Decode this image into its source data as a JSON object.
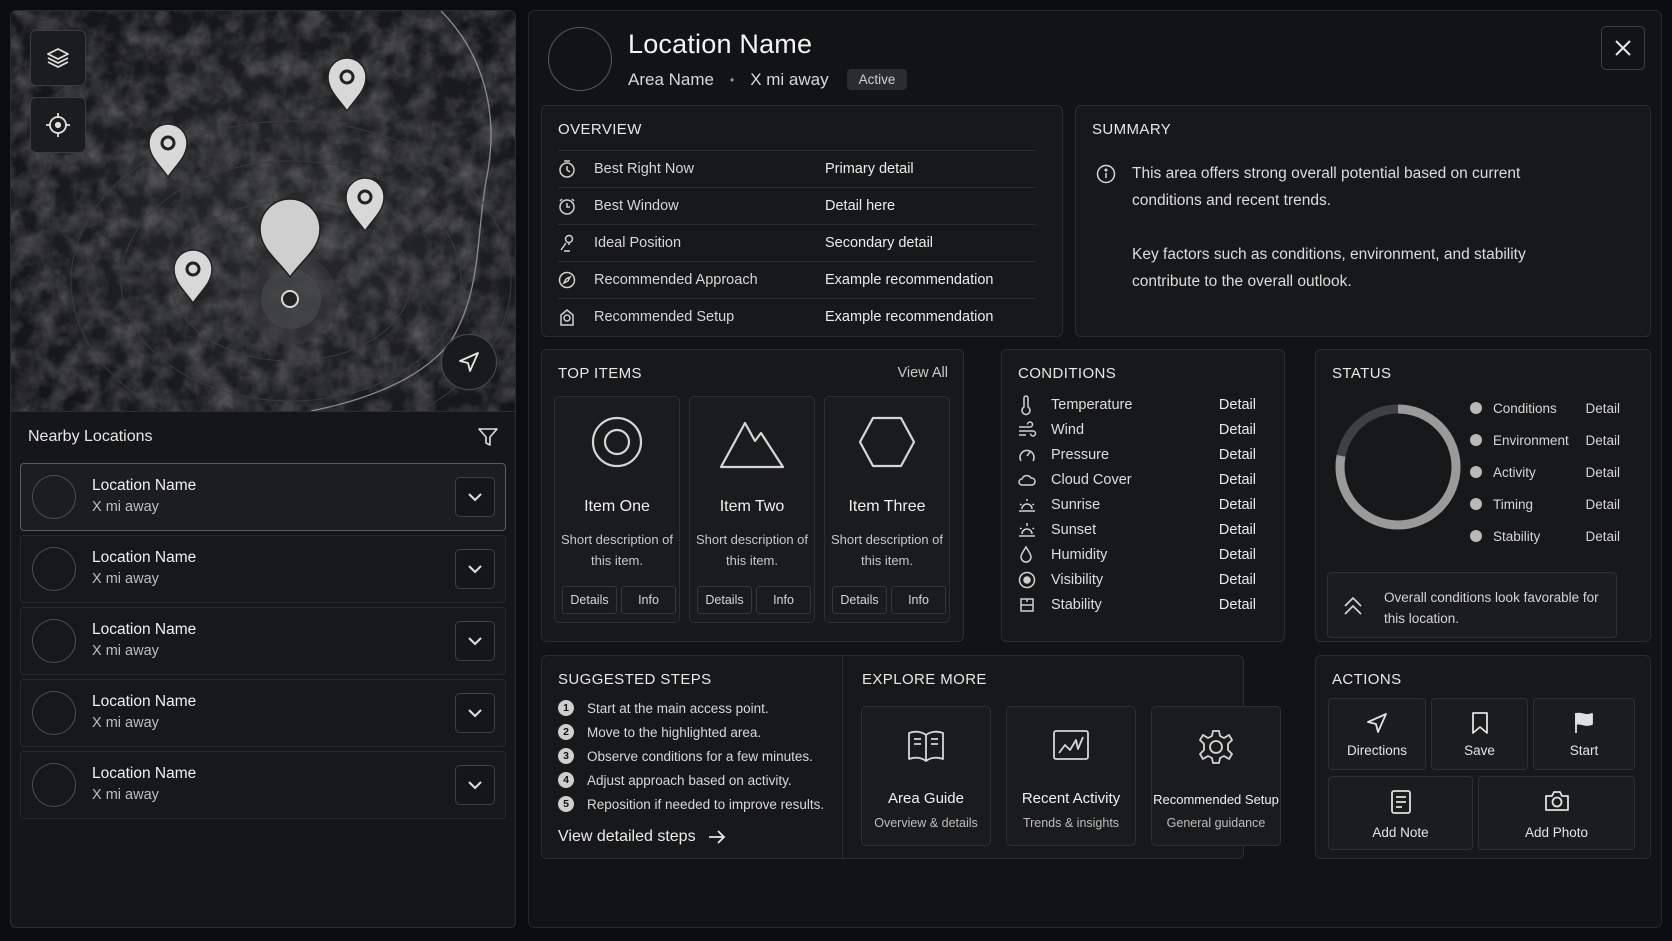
{
  "nearby": {
    "title": "Nearby Locations",
    "items": [
      {
        "name": "Location Name",
        "distance": "X mi away"
      },
      {
        "name": "Location Name",
        "distance": "X mi away"
      },
      {
        "name": "Location Name",
        "distance": "X mi away"
      },
      {
        "name": "Location Name",
        "distance": "X mi away"
      },
      {
        "name": "Location Name",
        "distance": "X mi away"
      }
    ]
  },
  "header": {
    "title": "Location Name",
    "area": "Area Name",
    "separator": "•",
    "distance": "X mi away",
    "badge": "Active"
  },
  "overview": {
    "title": "OVERVIEW",
    "rows": [
      {
        "icon": "clock-check-icon",
        "label": "Best Right Now",
        "value": "Primary detail"
      },
      {
        "icon": "clock-icon",
        "label": "Best Window",
        "value": "Detail here"
      },
      {
        "icon": "position-pin-icon",
        "label": "Ideal Position",
        "value": "Secondary detail"
      },
      {
        "icon": "compass-icon",
        "label": "Recommended Approach",
        "value": "Example recommendation"
      },
      {
        "icon": "setup-icon",
        "label": "Recommended Setup",
        "value": "Example recommendation"
      }
    ]
  },
  "summary": {
    "title": "SUMMARY",
    "paragraphs": [
      "This area offers strong overall potential based on current conditions and recent trends.",
      "Key factors such as conditions, environment, and stability contribute to the overall outlook."
    ]
  },
  "top_items": {
    "title": "TOP ITEMS",
    "view_all": "View All",
    "items": [
      {
        "name": "Item One",
        "desc": "Short description of this item.",
        "btn1": "Details",
        "btn2": "Info",
        "icon": "circle-icon"
      },
      {
        "name": "Item Two",
        "desc": "Short description of this item.",
        "btn1": "Details",
        "btn2": "Info",
        "icon": "mountain-icon"
      },
      {
        "name": "Item Three",
        "desc": "Short description of this item.",
        "btn1": "Details",
        "btn2": "Info",
        "icon": "hexagon-icon"
      }
    ]
  },
  "conditions": {
    "title": "CONDITIONS",
    "rows": [
      {
        "label": "Temperature",
        "value": "Detail",
        "icon": "thermometer-icon"
      },
      {
        "label": "Wind",
        "value": "Detail",
        "icon": "wind-icon"
      },
      {
        "label": "Pressure",
        "value": "Detail",
        "icon": "pressure-icon"
      },
      {
        "label": "Cloud Cover",
        "value": "Detail",
        "icon": "cloud-icon"
      },
      {
        "label": "Sunrise",
        "value": "Detail",
        "icon": "sunrise-icon"
      },
      {
        "label": "Sunset",
        "value": "Detail",
        "icon": "sunset-icon"
      },
      {
        "label": "Humidity",
        "value": "Detail",
        "icon": "droplet-icon"
      },
      {
        "label": "Visibility",
        "value": "Detail",
        "icon": "eye-icon"
      },
      {
        "label": "Stability",
        "value": "Detail",
        "icon": "stability-icon"
      }
    ]
  },
  "status": {
    "title": "STATUS",
    "rows": [
      {
        "label": "Conditions",
        "value": "Detail"
      },
      {
        "label": "Environment",
        "value": "Detail"
      },
      {
        "label": "Activity",
        "value": "Detail"
      },
      {
        "label": "Timing",
        "value": "Detail"
      },
      {
        "label": "Stability",
        "value": "Detail"
      }
    ],
    "ring_fraction": 0.78,
    "note": "Overall conditions look favorable for this location."
  },
  "steps": {
    "title": "SUGGESTED STEPS",
    "items": [
      {
        "num": "1",
        "text": "Start at the main access point."
      },
      {
        "num": "2",
        "text": "Move to the highlighted area."
      },
      {
        "num": "3",
        "text": "Observe conditions for a few minutes."
      },
      {
        "num": "4",
        "text": "Adjust approach based on activity."
      },
      {
        "num": "5",
        "text": "Reposition if needed to improve results."
      }
    ],
    "link": "View detailed steps"
  },
  "explore": {
    "title": "EXPLORE MORE",
    "items": [
      {
        "name": "Area Guide",
        "desc": "Overview & details",
        "icon": "book-icon"
      },
      {
        "name": "Recent Activity",
        "desc": "Trends & insights",
        "icon": "chart-icon"
      },
      {
        "name": "Recommended Setup",
        "desc": "General guidance",
        "icon": "gear-icon"
      }
    ]
  },
  "actions": {
    "title": "ACTIONS",
    "items": [
      {
        "label": "Directions",
        "icon": "navigation-icon"
      },
      {
        "label": "Save",
        "icon": "bookmark-icon"
      },
      {
        "label": "Start",
        "icon": "flag-icon"
      },
      {
        "label": "Add Note",
        "icon": "note-icon"
      },
      {
        "label": "Add Photo",
        "icon": "camera-icon"
      }
    ]
  },
  "colors": {
    "background": "#0b0c0d",
    "panel": "#17181a",
    "border": "#2a2c2f",
    "text": "#e6e6e6"
  }
}
